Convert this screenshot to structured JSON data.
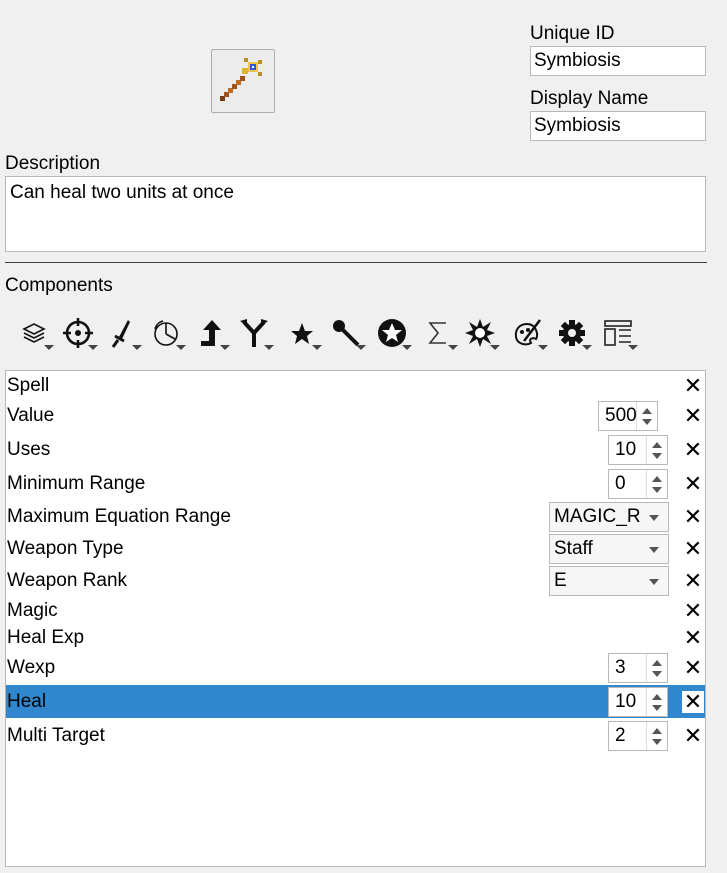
{
  "item_icon": "magic-staff-icon",
  "unique_id": {
    "label": "Unique ID",
    "value": "Symbiosis"
  },
  "display_name": {
    "label": "Display Name",
    "value": "Symbiosis"
  },
  "description": {
    "label": "Description",
    "value": "Can heal two units at once"
  },
  "components_label": "Components",
  "toolbar_icons": [
    "layers-icon",
    "crosshair-icon",
    "sword-icon",
    "pie-chart-icon",
    "arrow-up-icon",
    "fork-icon",
    "star-icon",
    "wrench-icon",
    "circle-star-icon",
    "sigma-icon",
    "burst-icon",
    "palette-icon",
    "gear-icon",
    "layout-icon"
  ],
  "rows": [
    {
      "name": "Spell"
    },
    {
      "name": "Value",
      "spin": "500"
    },
    {
      "name": "Uses",
      "spin": "10"
    },
    {
      "name": "Minimum Range",
      "spin": "0"
    },
    {
      "name": "Maximum Equation Range",
      "combo": "MAGIC_RANGE"
    },
    {
      "name": "Weapon Type",
      "combo": "Staff"
    },
    {
      "name": "Weapon Rank",
      "combo": "E"
    },
    {
      "name": "Magic"
    },
    {
      "name": "Heal Exp"
    },
    {
      "name": "Wexp",
      "spin": "3"
    },
    {
      "name": "Heal",
      "spin": "10",
      "selected": true
    },
    {
      "name": "Multi Target",
      "spin": "2"
    }
  ],
  "close_glyph": "✕",
  "selection_color": "#3087ce"
}
